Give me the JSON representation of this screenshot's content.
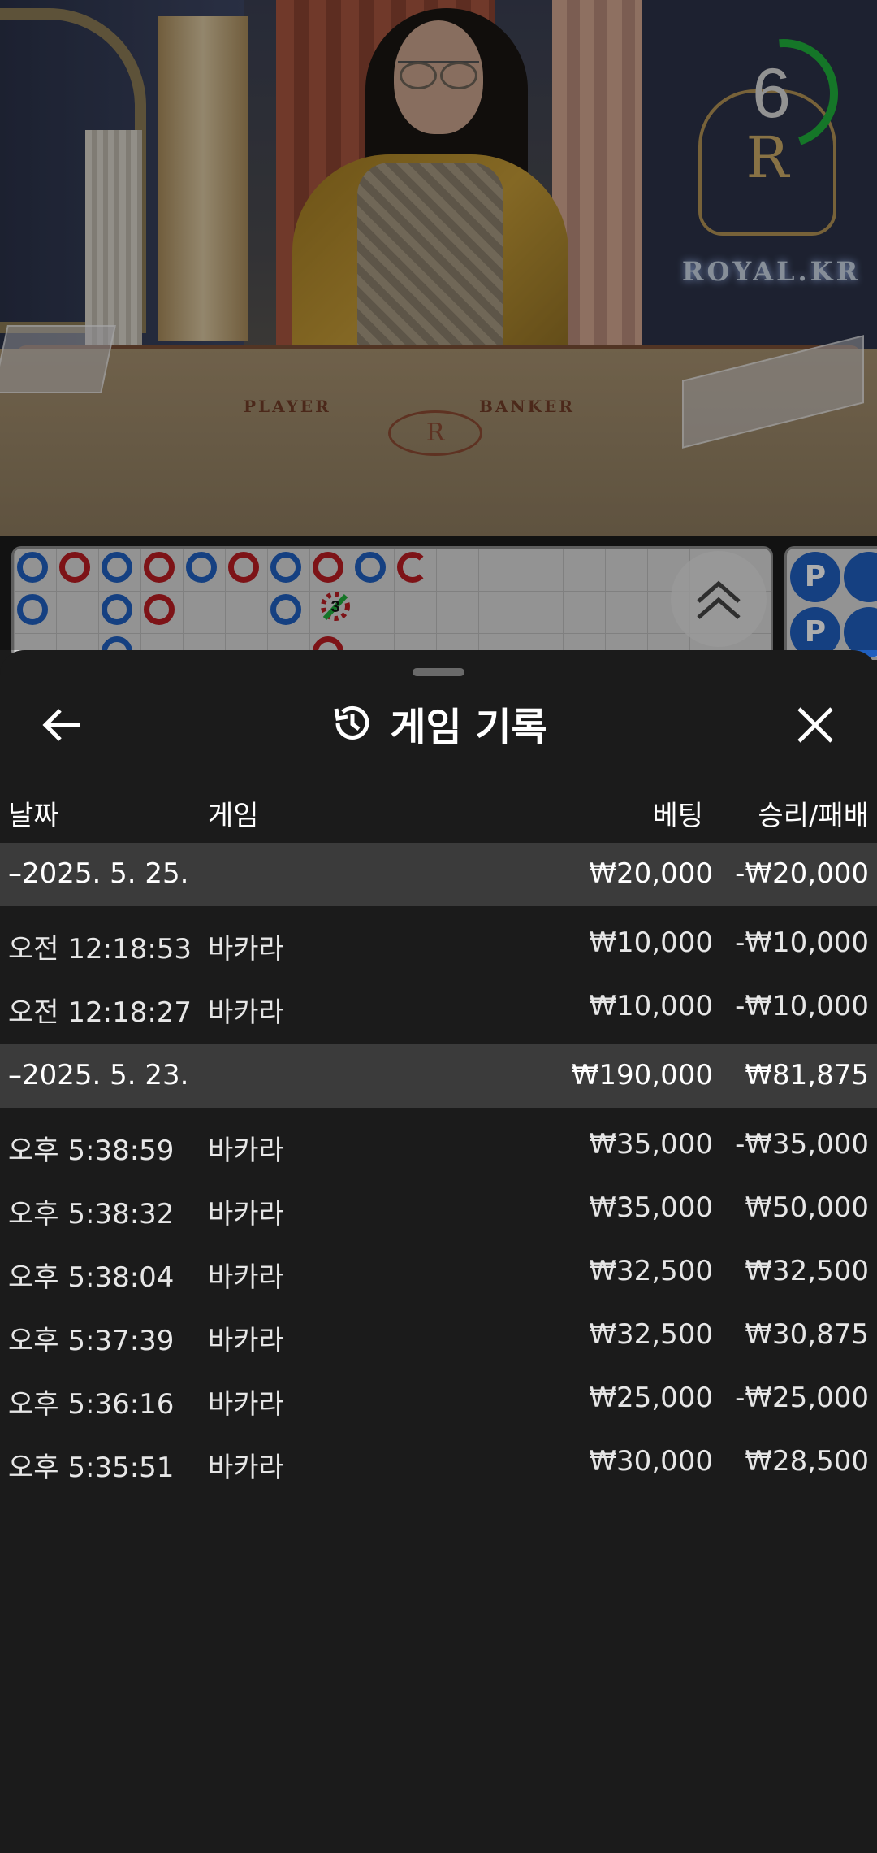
{
  "video": {
    "timer_value": "6",
    "table_labels": {
      "player": "PLAYER",
      "banker": "BANKER"
    },
    "brand_text": "ROYAL.KR",
    "crest_letter": "R",
    "timer_color": "#1fae3c"
  },
  "roadmap": {
    "colors": {
      "player": "#1f5fbf",
      "banker": "#b81c22",
      "tie": "#1fae3c"
    },
    "tie_count": "3",
    "bead_label": "P"
  },
  "sheet": {
    "title": "게임 기록",
    "icons": {
      "back": "arrow-left-icon",
      "history": "history-icon",
      "close": "close-icon",
      "scroll": "chevron-double-up-icon"
    },
    "columns": {
      "date": "날짜",
      "game": "게임",
      "bet": "베팅",
      "result": "승리/패배"
    },
    "groups": [
      {
        "date": "–2025. 5. 25.",
        "bet": "₩20,000",
        "result": "-₩20,000",
        "rows": [
          {
            "time": "오전 12:18:53",
            "game": "바카라",
            "bet": "₩10,000",
            "result": "-₩10,000"
          },
          {
            "time": "오전 12:18:27",
            "game": "바카라",
            "bet": "₩10,000",
            "result": "-₩10,000"
          }
        ]
      },
      {
        "date": "–2025. 5. 23.",
        "bet": "₩190,000",
        "result": "₩81,875",
        "rows": [
          {
            "time": "오후 5:38:59",
            "game": "바카라",
            "bet": "₩35,000",
            "result": "-₩35,000"
          },
          {
            "time": "오후 5:38:32",
            "game": "바카라",
            "bet": "₩35,000",
            "result": "₩50,000"
          },
          {
            "time": "오후 5:38:04",
            "game": "바카라",
            "bet": "₩32,500",
            "result": "₩32,500"
          },
          {
            "time": "오후 5:37:39",
            "game": "바카라",
            "bet": "₩32,500",
            "result": "₩30,875"
          },
          {
            "time": "오후 5:36:16",
            "game": "바카라",
            "bet": "₩25,000",
            "result": "-₩25,000"
          },
          {
            "time": "오후 5:35:51",
            "game": "바카라",
            "bet": "₩30,000",
            "result": "₩28,500"
          }
        ]
      }
    ]
  }
}
